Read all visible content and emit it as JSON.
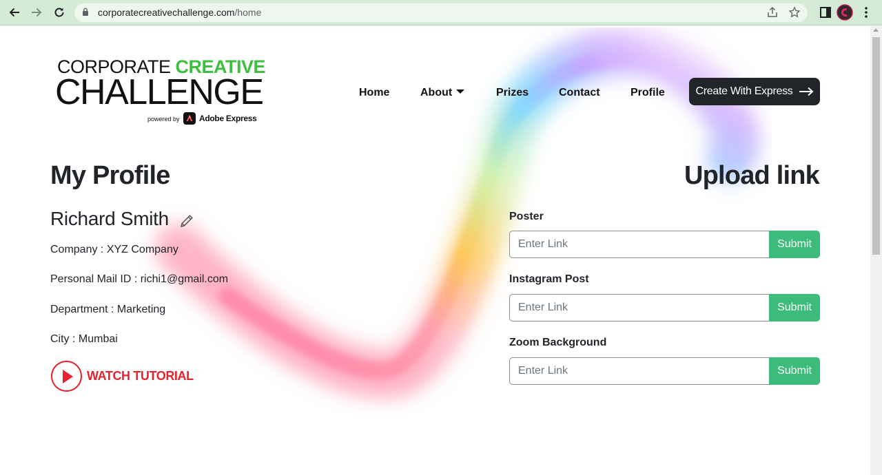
{
  "browser": {
    "url_host": "corporatecreativechallenge.com",
    "url_path": "/home"
  },
  "logo": {
    "line1_black": "CORPORATE",
    "line1_green": "CREATIVE",
    "line2": "CHALLENGE",
    "powered_by": "powered by",
    "adobe": "Adobe Express"
  },
  "nav": {
    "items": [
      {
        "label": "Home"
      },
      {
        "label": "About"
      },
      {
        "label": "Prizes"
      },
      {
        "label": "Contact"
      },
      {
        "label": "Profile"
      }
    ],
    "cta": "Create With Express"
  },
  "profile": {
    "heading": "My Profile",
    "name": "Richard Smith",
    "company": "Company : XYZ Company",
    "email": "Personal Mail ID : richi1@gmail.com",
    "department": "Department : Marketing",
    "city": "City : Mumbai",
    "tutorial": "WATCH TUTORIAL"
  },
  "upload": {
    "heading": "Upload link",
    "fields": [
      {
        "label": "Poster",
        "placeholder": "Enter Link",
        "button": "Submit"
      },
      {
        "label": "Instagram Post",
        "placeholder": "Enter Link",
        "button": "Submit"
      },
      {
        "label": "Zoom Background",
        "placeholder": "Enter Link",
        "button": "Submit"
      }
    ]
  },
  "colors": {
    "brand_green": "#3fbf3f",
    "submit_green": "#3dbb7a",
    "tutorial_red": "#e8222e",
    "dark_button": "#212529",
    "chrome_bar": "#d4ecd5"
  }
}
